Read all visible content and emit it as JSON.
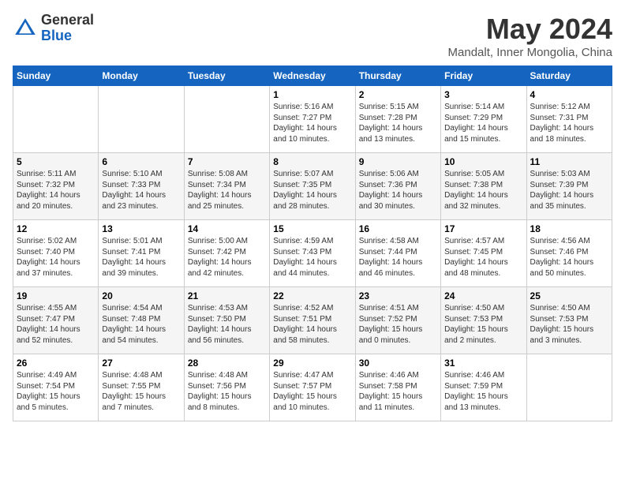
{
  "header": {
    "logo_general": "General",
    "logo_blue": "Blue",
    "month_title": "May 2024",
    "location": "Mandalt, Inner Mongolia, China"
  },
  "days_of_week": [
    "Sunday",
    "Monday",
    "Tuesday",
    "Wednesday",
    "Thursday",
    "Friday",
    "Saturday"
  ],
  "weeks": [
    [
      {
        "day": "",
        "info": ""
      },
      {
        "day": "",
        "info": ""
      },
      {
        "day": "",
        "info": ""
      },
      {
        "day": "1",
        "info": "Sunrise: 5:16 AM\nSunset: 7:27 PM\nDaylight: 14 hours\nand 10 minutes."
      },
      {
        "day": "2",
        "info": "Sunrise: 5:15 AM\nSunset: 7:28 PM\nDaylight: 14 hours\nand 13 minutes."
      },
      {
        "day": "3",
        "info": "Sunrise: 5:14 AM\nSunset: 7:29 PM\nDaylight: 14 hours\nand 15 minutes."
      },
      {
        "day": "4",
        "info": "Sunrise: 5:12 AM\nSunset: 7:31 PM\nDaylight: 14 hours\nand 18 minutes."
      }
    ],
    [
      {
        "day": "5",
        "info": "Sunrise: 5:11 AM\nSunset: 7:32 PM\nDaylight: 14 hours\nand 20 minutes."
      },
      {
        "day": "6",
        "info": "Sunrise: 5:10 AM\nSunset: 7:33 PM\nDaylight: 14 hours\nand 23 minutes."
      },
      {
        "day": "7",
        "info": "Sunrise: 5:08 AM\nSunset: 7:34 PM\nDaylight: 14 hours\nand 25 minutes."
      },
      {
        "day": "8",
        "info": "Sunrise: 5:07 AM\nSunset: 7:35 PM\nDaylight: 14 hours\nand 28 minutes."
      },
      {
        "day": "9",
        "info": "Sunrise: 5:06 AM\nSunset: 7:36 PM\nDaylight: 14 hours\nand 30 minutes."
      },
      {
        "day": "10",
        "info": "Sunrise: 5:05 AM\nSunset: 7:38 PM\nDaylight: 14 hours\nand 32 minutes."
      },
      {
        "day": "11",
        "info": "Sunrise: 5:03 AM\nSunset: 7:39 PM\nDaylight: 14 hours\nand 35 minutes."
      }
    ],
    [
      {
        "day": "12",
        "info": "Sunrise: 5:02 AM\nSunset: 7:40 PM\nDaylight: 14 hours\nand 37 minutes."
      },
      {
        "day": "13",
        "info": "Sunrise: 5:01 AM\nSunset: 7:41 PM\nDaylight: 14 hours\nand 39 minutes."
      },
      {
        "day": "14",
        "info": "Sunrise: 5:00 AM\nSunset: 7:42 PM\nDaylight: 14 hours\nand 42 minutes."
      },
      {
        "day": "15",
        "info": "Sunrise: 4:59 AM\nSunset: 7:43 PM\nDaylight: 14 hours\nand 44 minutes."
      },
      {
        "day": "16",
        "info": "Sunrise: 4:58 AM\nSunset: 7:44 PM\nDaylight: 14 hours\nand 46 minutes."
      },
      {
        "day": "17",
        "info": "Sunrise: 4:57 AM\nSunset: 7:45 PM\nDaylight: 14 hours\nand 48 minutes."
      },
      {
        "day": "18",
        "info": "Sunrise: 4:56 AM\nSunset: 7:46 PM\nDaylight: 14 hours\nand 50 minutes."
      }
    ],
    [
      {
        "day": "19",
        "info": "Sunrise: 4:55 AM\nSunset: 7:47 PM\nDaylight: 14 hours\nand 52 minutes."
      },
      {
        "day": "20",
        "info": "Sunrise: 4:54 AM\nSunset: 7:48 PM\nDaylight: 14 hours\nand 54 minutes."
      },
      {
        "day": "21",
        "info": "Sunrise: 4:53 AM\nSunset: 7:50 PM\nDaylight: 14 hours\nand 56 minutes."
      },
      {
        "day": "22",
        "info": "Sunrise: 4:52 AM\nSunset: 7:51 PM\nDaylight: 14 hours\nand 58 minutes."
      },
      {
        "day": "23",
        "info": "Sunrise: 4:51 AM\nSunset: 7:52 PM\nDaylight: 15 hours\nand 0 minutes."
      },
      {
        "day": "24",
        "info": "Sunrise: 4:50 AM\nSunset: 7:53 PM\nDaylight: 15 hours\nand 2 minutes."
      },
      {
        "day": "25",
        "info": "Sunrise: 4:50 AM\nSunset: 7:53 PM\nDaylight: 15 hours\nand 3 minutes."
      }
    ],
    [
      {
        "day": "26",
        "info": "Sunrise: 4:49 AM\nSunset: 7:54 PM\nDaylight: 15 hours\nand 5 minutes."
      },
      {
        "day": "27",
        "info": "Sunrise: 4:48 AM\nSunset: 7:55 PM\nDaylight: 15 hours\nand 7 minutes."
      },
      {
        "day": "28",
        "info": "Sunrise: 4:48 AM\nSunset: 7:56 PM\nDaylight: 15 hours\nand 8 minutes."
      },
      {
        "day": "29",
        "info": "Sunrise: 4:47 AM\nSunset: 7:57 PM\nDaylight: 15 hours\nand 10 minutes."
      },
      {
        "day": "30",
        "info": "Sunrise: 4:46 AM\nSunset: 7:58 PM\nDaylight: 15 hours\nand 11 minutes."
      },
      {
        "day": "31",
        "info": "Sunrise: 4:46 AM\nSunset: 7:59 PM\nDaylight: 15 hours\nand 13 minutes."
      },
      {
        "day": "",
        "info": ""
      }
    ]
  ]
}
